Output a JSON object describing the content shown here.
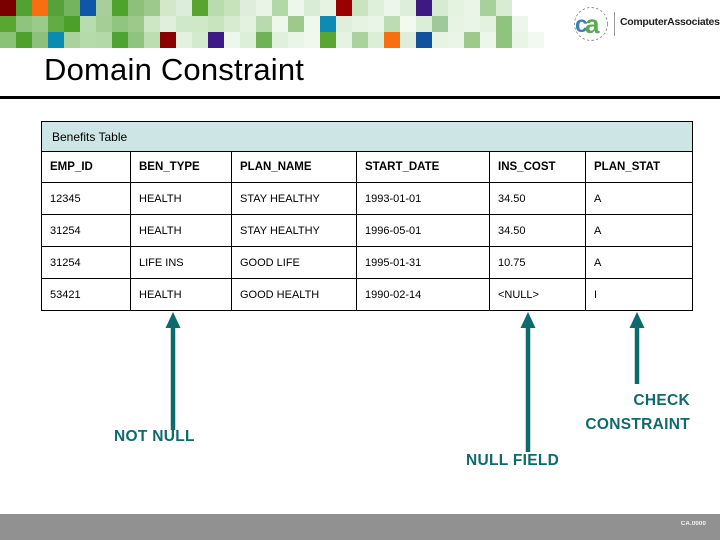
{
  "slide": {
    "title": "Domain Constraint",
    "footer_code": "CA.0000"
  },
  "brand": {
    "logo_letters": "ca",
    "wordmark": "ComputerAssociates",
    "trademark": "™",
    "logo_c_color": "#3b7fb5",
    "logo_a_color": "#5aa84f",
    "footer_bar_color": "#919191"
  },
  "header_mosaic": {
    "cell_size": 16,
    "rows": 3,
    "colors": [
      [
        "#7a0000",
        "#53a231",
        "#f96e11",
        "#57a13a",
        "#74b45e",
        "#0d56a8",
        "#a8cf9a",
        "#4da32c",
        "#8cc07b",
        "#9dc98d",
        "#d3e8c9",
        "#dceedb",
        "#57a431",
        "#b9dcae",
        "#c6e3bc",
        "#dfeedc",
        "#e9f4e6",
        "#b3d8a8",
        "#eef7ec",
        "#d9ecd5",
        "#e6f3e3",
        "#9b0000",
        "#c9e4be",
        "#dff0da",
        "#edf6ea",
        "#ddeeda",
        "#3c1a80",
        "#d7ebd2",
        "#e4f2e0",
        "#eaf5e7",
        "#a7d09a",
        "#d8ecd3",
        "#ffffff",
        "#ffffff",
        "#ffffff",
        "#ffffff"
      ],
      [
        "#5aa632",
        "#8fc47e",
        "#9acb8a",
        "#63ab45",
        "#4aa028",
        "#b9dcae",
        "#a4ce96",
        "#90c57f",
        "#9dc98d",
        "#cde6c4",
        "#e0efdc",
        "#cfe8c8",
        "#cfe8c8",
        "#c8e4bf",
        "#d7ebd2",
        "#e3f1df",
        "#b7dbad",
        "#eef7ec",
        "#9dc98d",
        "#f0f8ee",
        "#0c8cb4",
        "#e0efdc",
        "#e6f3e2",
        "#e9f5e6",
        "#bcddb2",
        "#f2f9f0",
        "#dbeed7",
        "#9ec99a",
        "#e7f4e4",
        "#e9f5e6",
        "#e3f1df",
        "#8fc47e",
        "#edf6ea",
        "#ffffff",
        "#ffffff",
        "#ffffff"
      ],
      [
        "#8ac377",
        "#4ea12d",
        "#8cc07b",
        "#0b8ab2",
        "#a9d29c",
        "#b5dbab",
        "#b2d9a7",
        "#4fa330",
        "#8ec47d",
        "#bddeb3",
        "#8b0000",
        "#e3f1df",
        "#d4eacf",
        "#3d1a86",
        "#eef7ec",
        "#dcefd8",
        "#6fb356",
        "#dff0db",
        "#e9f5e6",
        "#f0f8ee",
        "#5aa632",
        "#e6f3e2",
        "#a9d29c",
        "#dbeed7",
        "#f76f10",
        "#dfeedc",
        "#11529f",
        "#e7f4e4",
        "#eaf5e7",
        "#9dc98d",
        "#edf6ea",
        "#8ec47d",
        "#e8f4e5",
        "#f2f9f0",
        "#ffffff",
        "#ffffff"
      ]
    ]
  },
  "table": {
    "caption": "Benefits Table",
    "caption_bg": "#cde5e4",
    "columns": [
      "EMP_ID",
      "BEN_TYPE",
      "PLAN_NAME",
      "START_DATE",
      "INS_COST",
      "PLAN_STAT"
    ],
    "rows": [
      [
        "12345",
        "HEALTH",
        "STAY HEALTHY",
        "1993-01-01",
        "34.50",
        "A"
      ],
      [
        "31254",
        "HEALTH",
        "STAY HEALTHY",
        "1996-05-01",
        "34.50",
        "A"
      ],
      [
        "31254",
        "LIFE INS",
        "GOOD LIFE",
        "1995-01-31",
        "10.75",
        "A"
      ],
      [
        "53421",
        "HEALTH",
        "GOOD HEALTH",
        "1990-02-14",
        "<NULL>",
        "I"
      ]
    ]
  },
  "annotations": {
    "color": "#0d6a6d",
    "items": [
      {
        "label": "NOT NULL",
        "target_column": "EMP_ID"
      },
      {
        "label": "NULL FIELD",
        "target_column": "INS_COST"
      },
      {
        "label_line1": "CHECK",
        "label_line2": "CONSTRAINT",
        "target_column": "PLAN_STAT"
      }
    ]
  }
}
